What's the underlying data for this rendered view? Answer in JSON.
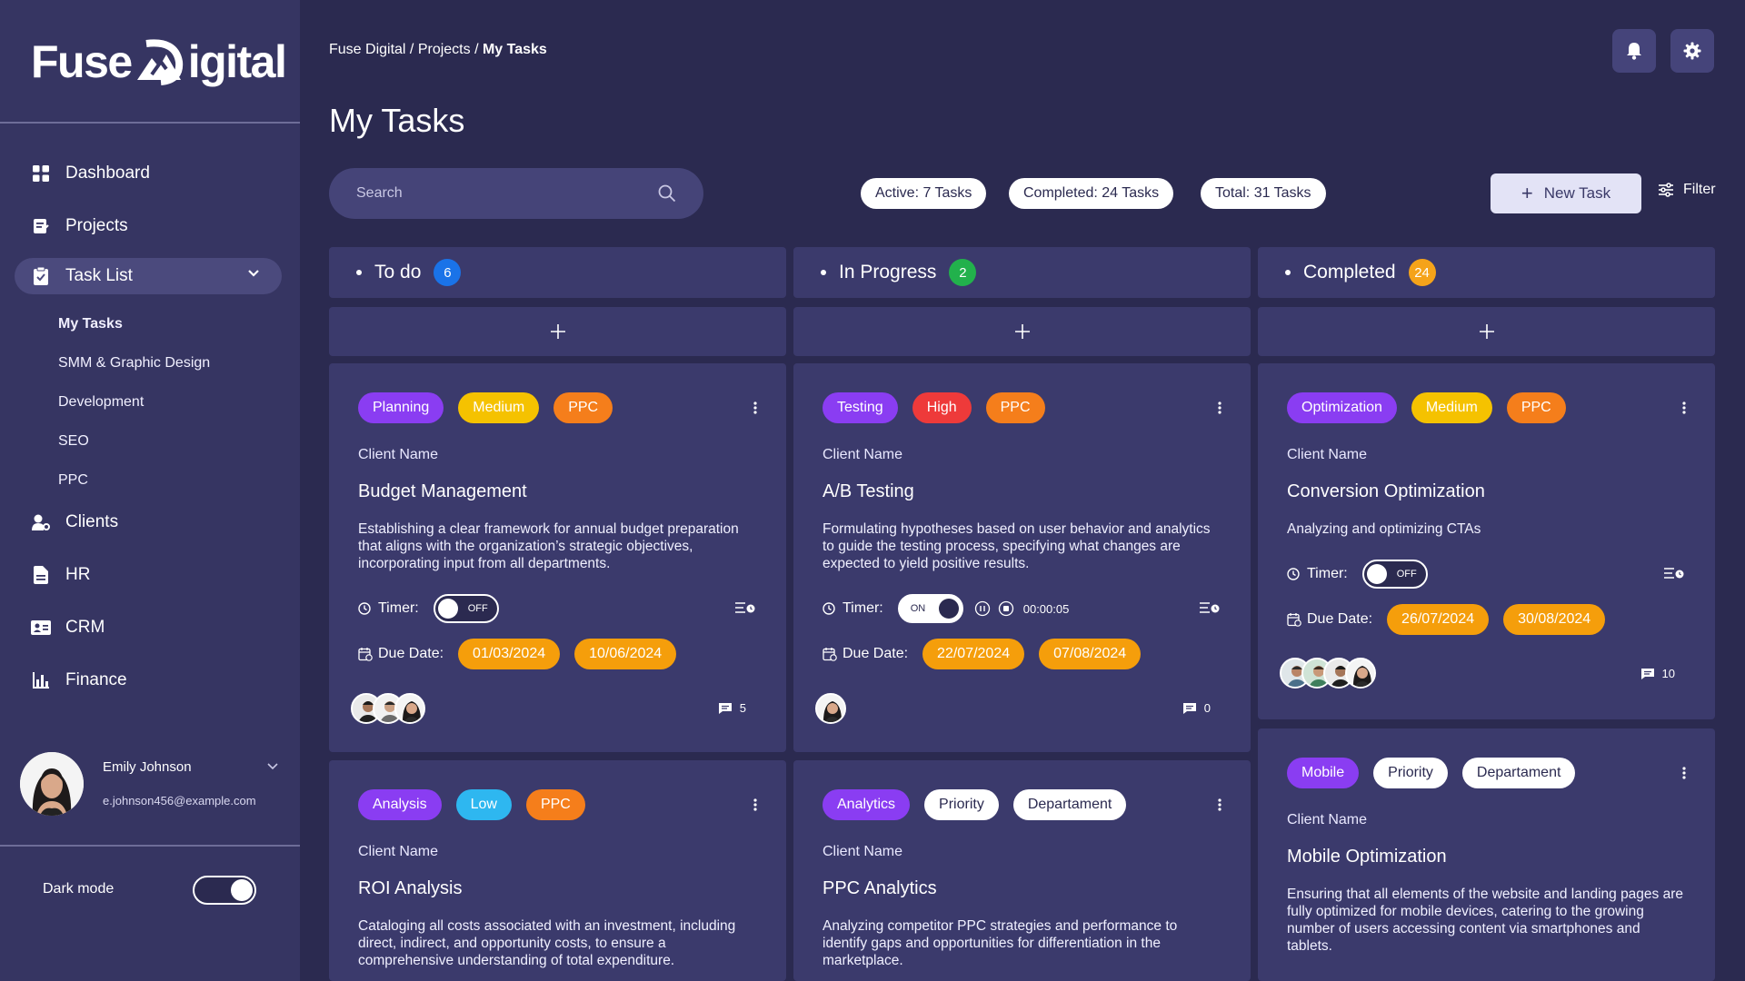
{
  "brand": {
    "logo_left": "Fuse",
    "logo_right": "igital"
  },
  "sidebar": {
    "items": [
      {
        "label": "Dashboard",
        "icon": "grid-icon"
      },
      {
        "label": "Projects",
        "icon": "notes-icon"
      },
      {
        "label": "Task List",
        "icon": "clipboard-icon"
      },
      {
        "label": "Clients",
        "icon": "user-gear-icon"
      },
      {
        "label": "HR",
        "icon": "document-icon"
      },
      {
        "label": "CRM",
        "icon": "id-card-icon"
      },
      {
        "label": "Finance",
        "icon": "bar-chart-icon"
      }
    ],
    "subitems": [
      "My Tasks",
      "SMM & Graphic Design",
      "Development",
      "SEO",
      "PPC"
    ],
    "user": {
      "name": "Emily Johnson",
      "email": "e.johnson456@example.com"
    },
    "dark_mode_label": "Dark mode",
    "dark_mode_on": true
  },
  "header": {
    "breadcrumb": {
      "root": "Fuse Digital",
      "sep1": " / ",
      "mid": "Projects",
      "sep2": " / ",
      "current": "My Tasks"
    },
    "title": "My Tasks"
  },
  "toolbar": {
    "search_placeholder": "Search",
    "stats": [
      "Active: 7 Tasks",
      "Completed: 24 Tasks",
      "Total: 31 Tasks"
    ],
    "new_task": "New Task",
    "filter": "Filter"
  },
  "columns": [
    {
      "title": "To do",
      "count": "6",
      "color": "#1a73e8"
    },
    {
      "title": "In Progress",
      "count": "2",
      "color": "#22b14c"
    },
    {
      "title": "Completed",
      "count": "24",
      "color": "#f5a31a"
    }
  ],
  "labels": {
    "client": "Client Name",
    "timer": "Timer:",
    "due": "Due Date:",
    "off": "OFF",
    "on": "ON"
  },
  "cards": [
    {
      "tags": [
        "Planning",
        "Medium",
        "PPC"
      ],
      "client": "Client Name",
      "title": "Budget Management",
      "description": "Establishing a clear framework for annual budget preparation that aligns with the organization’s strategic objectives, incorporating input from all departments.",
      "timer": "OFF",
      "dates": [
        "01/03/2024",
        "10/06/2024"
      ],
      "comments": "5"
    },
    {
      "tags": [
        "Testing",
        "High",
        "PPC"
      ],
      "client": "Client Name",
      "title": "A/B Testing",
      "description": "Formulating hypotheses based on user behavior and analytics to guide the testing process, specifying what changes are expected to yield positive results.",
      "timer": "ON",
      "elapsed": "00:00:05",
      "dates": [
        "22/07/2024",
        "07/08/2024"
      ],
      "comments": "0"
    },
    {
      "tags": [
        "Optimization",
        "Medium",
        "PPC"
      ],
      "client": "Client Name",
      "title": "Conversion Optimization",
      "description": "Analyzing and optimizing CTAs",
      "timer": "OFF",
      "dates": [
        "26/07/2024",
        "30/08/2024"
      ],
      "comments": "10"
    },
    {
      "tags": [
        "Analysis",
        "Low",
        "PPC"
      ],
      "client": "Client Name",
      "title": "ROI Analysis",
      "description": "Cataloging all costs associated with an investment, including direct, indirect, and opportunity costs, to ensure a comprehensive understanding of total expenditure."
    },
    {
      "tags": [
        "Analytics",
        "Priority",
        "Departament"
      ],
      "client": "Client Name",
      "title": "PPC Analytics",
      "description": "Analyzing competitor PPC strategies and performance to identify gaps and opportunities for differentiation in the marketplace."
    },
    {
      "tags": [
        "Mobile",
        "Priority",
        "Departament"
      ],
      "client": "Client Name",
      "title": "Mobile Optimization",
      "description": "Ensuring that all elements of the website and landing pages are fully optimized for mobile devices, catering to the growing number of users accessing content via smartphones and tablets."
    }
  ],
  "colors": {
    "background": "#2b2a50",
    "sidebar": "#363562",
    "card": "#3b3a6c",
    "date_pill": "#f59e0b"
  }
}
